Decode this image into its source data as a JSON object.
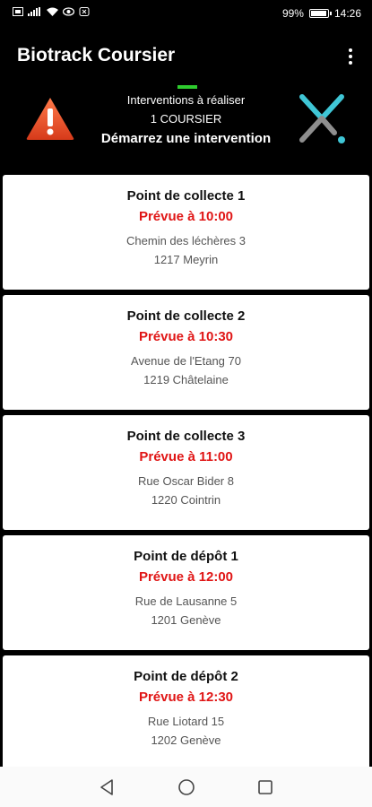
{
  "status_bar": {
    "left_icons": [
      "sim-icon",
      "signal-icon",
      "wifi-icon",
      "eye-icon",
      "nfc-icon"
    ],
    "battery_percent": "99%",
    "battery_level": 0.99,
    "time": "14:26"
  },
  "app_bar": {
    "title": "Biotrack Coursier",
    "menu_icon": "overflow-menu-icon"
  },
  "banner": {
    "line1": "Interventions à réaliser",
    "line2": "1 COURSIER",
    "line3": "Démarrez une intervention",
    "warning_icon": "warning-icon",
    "logo_icon": "biotrack-logo-icon",
    "colors": {
      "warning": "#e8502a",
      "logo_teal": "#3fc6d6",
      "logo_grey": "#8e8e8e",
      "indicator": "#2ecc2e"
    }
  },
  "cards": [
    {
      "title": "Point de collecte 1",
      "time": "Prévue à 10:00",
      "street": "Chemin des léchères 3",
      "city": "1217 Meyrin"
    },
    {
      "title": "Point de collecte 2",
      "time": "Prévue à 10:30",
      "street": "Avenue de l'Etang 70",
      "city": "1219 Châtelaine"
    },
    {
      "title": "Point de collecte 3",
      "time": "Prévue à 11:00",
      "street": "Rue Oscar Bider 8",
      "city": "1220 Cointrin"
    },
    {
      "title": "Point de dépôt 1",
      "time": "Prévue à 12:00",
      "street": "Rue de Lausanne 5",
      "city": "1201 Genève"
    },
    {
      "title": "Point de dépôt 2",
      "time": "Prévue à 12:30",
      "street": "Rue Liotard 15",
      "city": "1202 Genève"
    }
  ],
  "nav_bar": {
    "back_icon": "back-triangle-icon",
    "home_icon": "home-circle-icon",
    "recents_icon": "recents-square-icon"
  },
  "colors": {
    "time_red": "#e01515",
    "background": "#000000",
    "card": "#ffffff"
  }
}
